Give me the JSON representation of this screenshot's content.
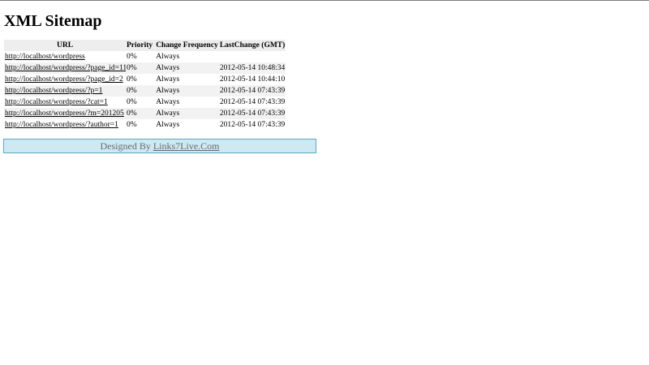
{
  "page": {
    "title": "XML Sitemap"
  },
  "table": {
    "headers": {
      "url": "URL",
      "priority": "Priority",
      "change_frequency": "Change Frequency",
      "last_change": "LastChange (GMT)"
    },
    "rows": [
      {
        "url": "http://localhost/wordpress",
        "priority": "0%",
        "change_frequency": "Always",
        "last_change": ""
      },
      {
        "url": "http://localhost/wordpress/?page_id=11",
        "priority": "0%",
        "change_frequency": "Always",
        "last_change": "2012-05-14 10:48:34"
      },
      {
        "url": "http://localhost/wordpress/?page_id=2",
        "priority": "0%",
        "change_frequency": "Always",
        "last_change": "2012-05-14 10:44:10"
      },
      {
        "url": "http://localhost/wordpress/?p=1",
        "priority": "0%",
        "change_frequency": "Always",
        "last_change": "2012-05-14 07:43:39"
      },
      {
        "url": "http://localhost/wordpress/?cat=1",
        "priority": "0%",
        "change_frequency": "Always",
        "last_change": "2012-05-14 07:43:39"
      },
      {
        "url": "http://localhost/wordpress/?m=201205",
        "priority": "0%",
        "change_frequency": "Always",
        "last_change": "2012-05-14 07:43:39"
      },
      {
        "url": "http://localhost/wordpress/?author=1",
        "priority": "0%",
        "change_frequency": "Always",
        "last_change": "2012-05-14 07:43:39"
      }
    ]
  },
  "footer": {
    "prefix": "Designed By",
    "link_text": "Links7Live.Com",
    "background_color": "#cfe9f3",
    "border_color": "#5aa9c4"
  }
}
